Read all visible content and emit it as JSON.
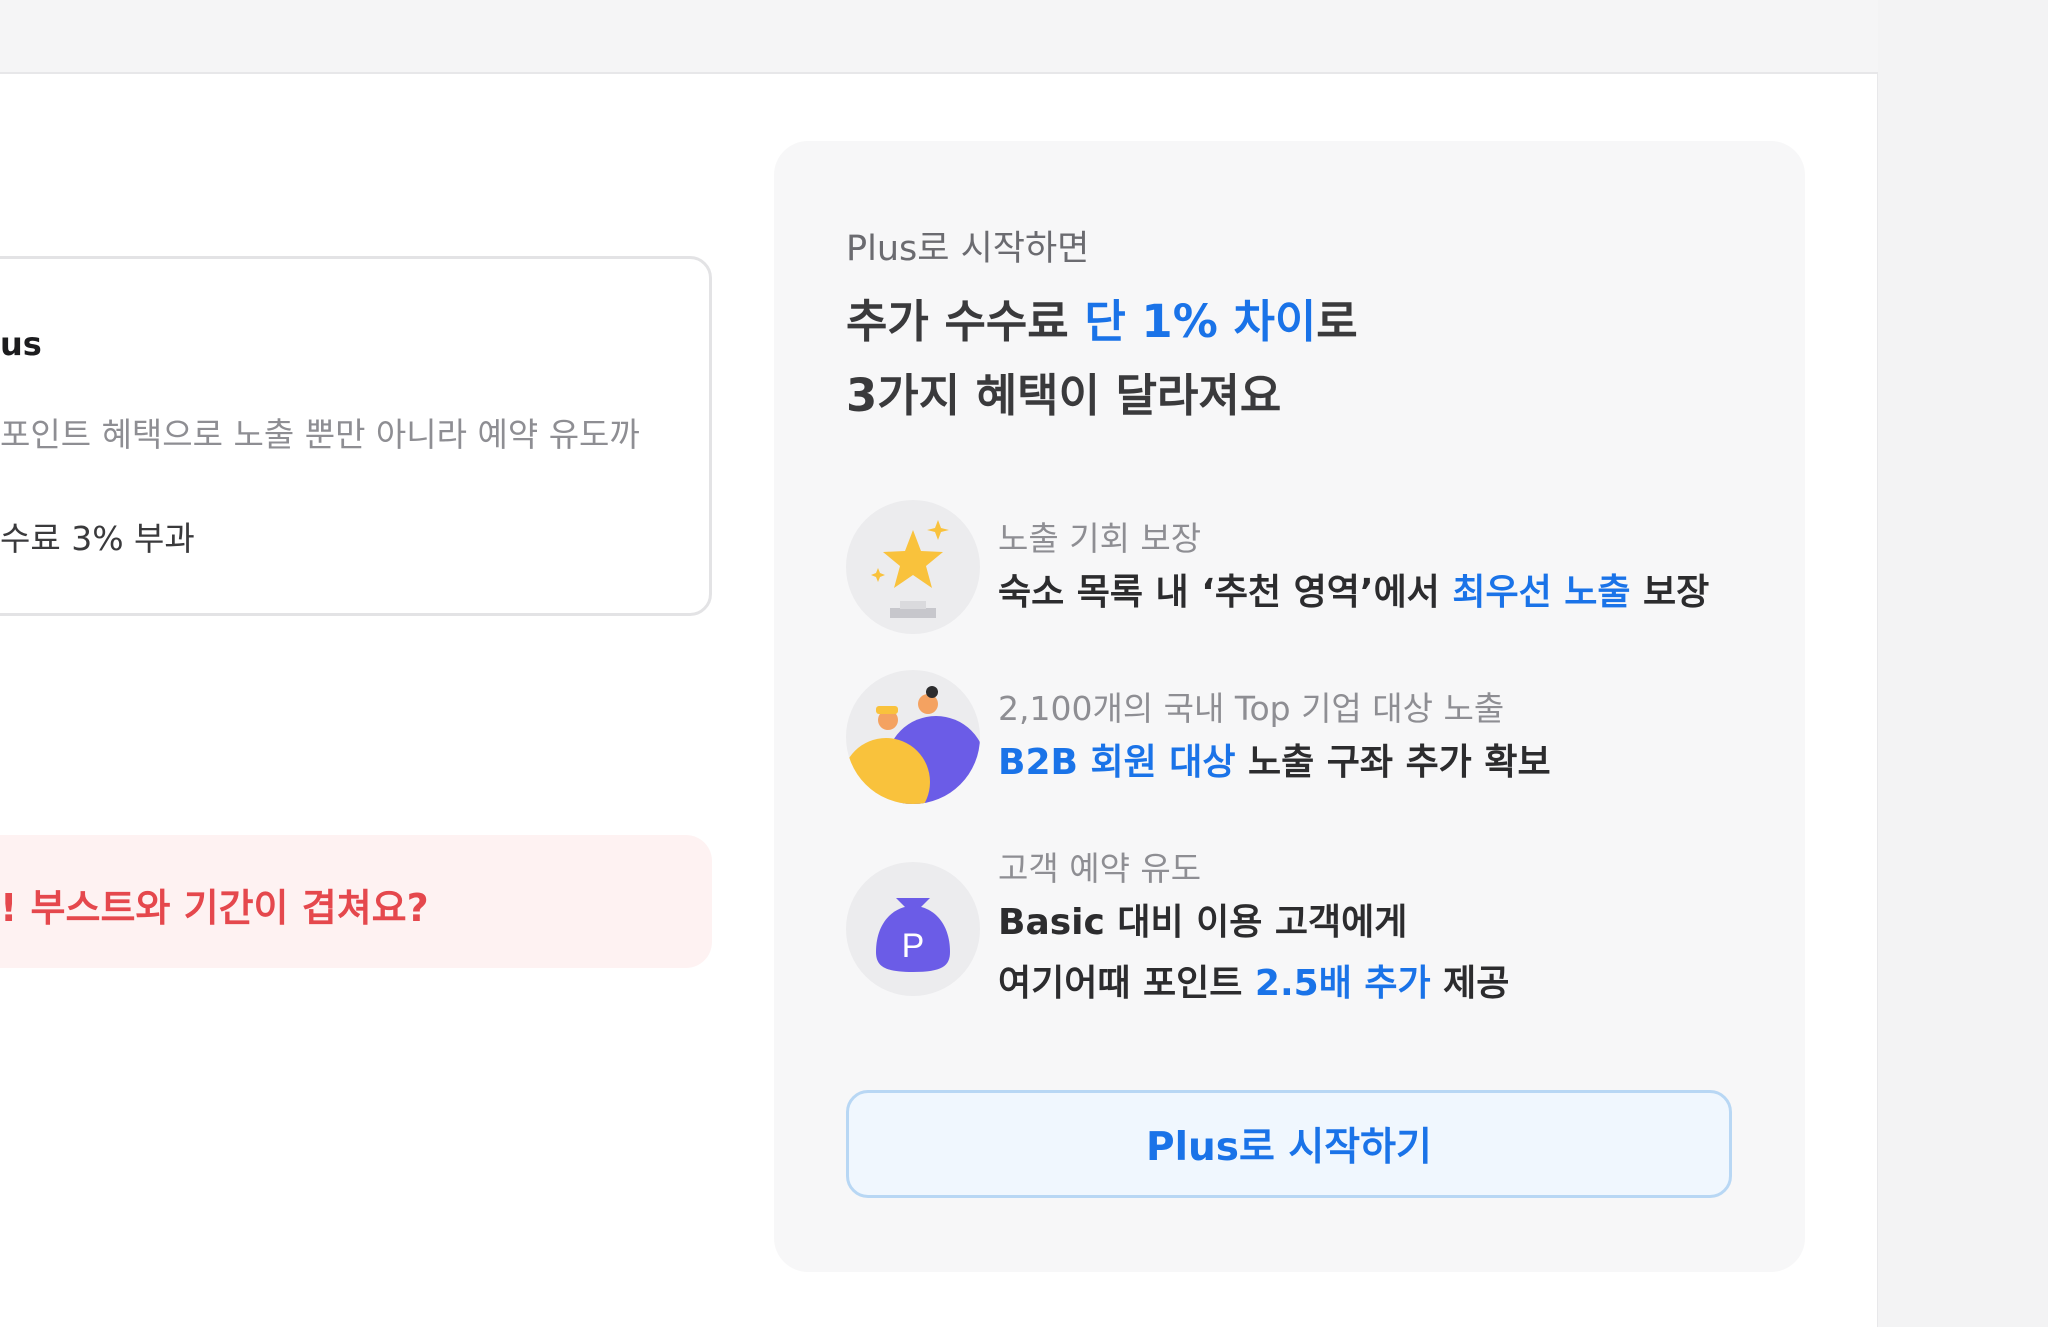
{
  "plan_card": {
    "name": "us",
    "description": "포인트 혜택으로 노출 뿐만 아니라 예약 유도까",
    "fee": "수료 3% 부과"
  },
  "warning": {
    "text": "! 부스트와 기간이 겹쳐요?"
  },
  "panel": {
    "subtitle": "Plus로 시작하면",
    "headline_line1_prefix": "추가 수수료 ",
    "headline_line1_highlight": "단 1% 차이",
    "headline_line1_suffix": "로",
    "headline_line2": "3가지 혜택이 달라져요",
    "benefits": [
      {
        "icon": "star-trophy-icon",
        "label": "노출 기회 보장",
        "desc_prefix": "숙소 목록 내 ‘추천 영역’에서 ",
        "desc_highlight": "최우선 노출",
        "desc_suffix": " 보장"
      },
      {
        "icon": "people-icon",
        "label": "2,100개의 국내 Top 기업 대상 노출",
        "desc_highlight": "B2B 회원 대상",
        "desc_suffix": " 노출 구좌 추가 확보"
      },
      {
        "icon": "point-pouch-icon",
        "icon_letter": "P",
        "label": "고객 예약 유도",
        "desc_line1": "Basic 대비 이용 고객에게",
        "desc_line2_prefix": "여기어때 포인트 ",
        "desc_line2_highlight": "2.5배 추가",
        "desc_line2_suffix": " 제공"
      }
    ],
    "cta_label": "Plus로 시작하기"
  },
  "colors": {
    "accent_blue": "#1a73e8",
    "warning_red": "#e5484d",
    "panel_bg": "#f7f7f8",
    "star_yellow": "#f9c23c",
    "people_purple": "#6b5ce7"
  }
}
